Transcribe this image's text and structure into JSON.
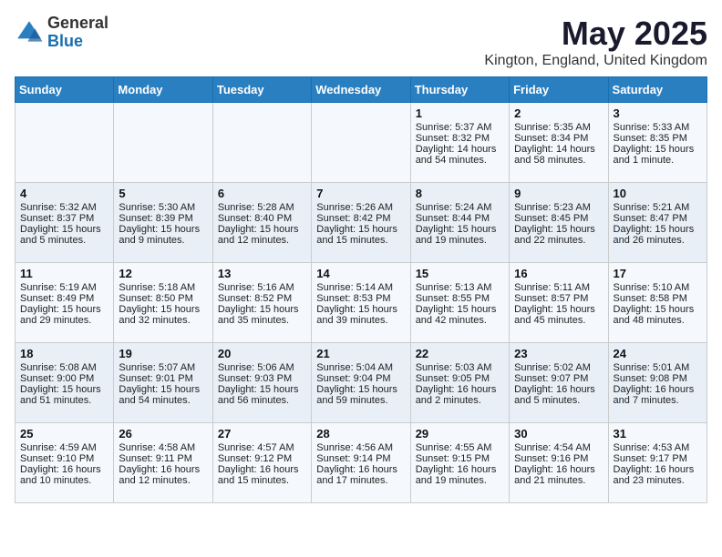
{
  "header": {
    "logo_general": "General",
    "logo_blue": "Blue",
    "month_title": "May 2025",
    "location": "Kington, England, United Kingdom"
  },
  "days_of_week": [
    "Sunday",
    "Monday",
    "Tuesday",
    "Wednesday",
    "Thursday",
    "Friday",
    "Saturday"
  ],
  "weeks": [
    [
      {
        "num": "",
        "sunrise": "",
        "sunset": "",
        "daylight": ""
      },
      {
        "num": "",
        "sunrise": "",
        "sunset": "",
        "daylight": ""
      },
      {
        "num": "",
        "sunrise": "",
        "sunset": "",
        "daylight": ""
      },
      {
        "num": "",
        "sunrise": "",
        "sunset": "",
        "daylight": ""
      },
      {
        "num": "1",
        "sunrise": "Sunrise: 5:37 AM",
        "sunset": "Sunset: 8:32 PM",
        "daylight": "Daylight: 14 hours and 54 minutes."
      },
      {
        "num": "2",
        "sunrise": "Sunrise: 5:35 AM",
        "sunset": "Sunset: 8:34 PM",
        "daylight": "Daylight: 14 hours and 58 minutes."
      },
      {
        "num": "3",
        "sunrise": "Sunrise: 5:33 AM",
        "sunset": "Sunset: 8:35 PM",
        "daylight": "Daylight: 15 hours and 1 minute."
      }
    ],
    [
      {
        "num": "4",
        "sunrise": "Sunrise: 5:32 AM",
        "sunset": "Sunset: 8:37 PM",
        "daylight": "Daylight: 15 hours and 5 minutes."
      },
      {
        "num": "5",
        "sunrise": "Sunrise: 5:30 AM",
        "sunset": "Sunset: 8:39 PM",
        "daylight": "Daylight: 15 hours and 9 minutes."
      },
      {
        "num": "6",
        "sunrise": "Sunrise: 5:28 AM",
        "sunset": "Sunset: 8:40 PM",
        "daylight": "Daylight: 15 hours and 12 minutes."
      },
      {
        "num": "7",
        "sunrise": "Sunrise: 5:26 AM",
        "sunset": "Sunset: 8:42 PM",
        "daylight": "Daylight: 15 hours and 15 minutes."
      },
      {
        "num": "8",
        "sunrise": "Sunrise: 5:24 AM",
        "sunset": "Sunset: 8:44 PM",
        "daylight": "Daylight: 15 hours and 19 minutes."
      },
      {
        "num": "9",
        "sunrise": "Sunrise: 5:23 AM",
        "sunset": "Sunset: 8:45 PM",
        "daylight": "Daylight: 15 hours and 22 minutes."
      },
      {
        "num": "10",
        "sunrise": "Sunrise: 5:21 AM",
        "sunset": "Sunset: 8:47 PM",
        "daylight": "Daylight: 15 hours and 26 minutes."
      }
    ],
    [
      {
        "num": "11",
        "sunrise": "Sunrise: 5:19 AM",
        "sunset": "Sunset: 8:49 PM",
        "daylight": "Daylight: 15 hours and 29 minutes."
      },
      {
        "num": "12",
        "sunrise": "Sunrise: 5:18 AM",
        "sunset": "Sunset: 8:50 PM",
        "daylight": "Daylight: 15 hours and 32 minutes."
      },
      {
        "num": "13",
        "sunrise": "Sunrise: 5:16 AM",
        "sunset": "Sunset: 8:52 PM",
        "daylight": "Daylight: 15 hours and 35 minutes."
      },
      {
        "num": "14",
        "sunrise": "Sunrise: 5:14 AM",
        "sunset": "Sunset: 8:53 PM",
        "daylight": "Daylight: 15 hours and 39 minutes."
      },
      {
        "num": "15",
        "sunrise": "Sunrise: 5:13 AM",
        "sunset": "Sunset: 8:55 PM",
        "daylight": "Daylight: 15 hours and 42 minutes."
      },
      {
        "num": "16",
        "sunrise": "Sunrise: 5:11 AM",
        "sunset": "Sunset: 8:57 PM",
        "daylight": "Daylight: 15 hours and 45 minutes."
      },
      {
        "num": "17",
        "sunrise": "Sunrise: 5:10 AM",
        "sunset": "Sunset: 8:58 PM",
        "daylight": "Daylight: 15 hours and 48 minutes."
      }
    ],
    [
      {
        "num": "18",
        "sunrise": "Sunrise: 5:08 AM",
        "sunset": "Sunset: 9:00 PM",
        "daylight": "Daylight: 15 hours and 51 minutes."
      },
      {
        "num": "19",
        "sunrise": "Sunrise: 5:07 AM",
        "sunset": "Sunset: 9:01 PM",
        "daylight": "Daylight: 15 hours and 54 minutes."
      },
      {
        "num": "20",
        "sunrise": "Sunrise: 5:06 AM",
        "sunset": "Sunset: 9:03 PM",
        "daylight": "Daylight: 15 hours and 56 minutes."
      },
      {
        "num": "21",
        "sunrise": "Sunrise: 5:04 AM",
        "sunset": "Sunset: 9:04 PM",
        "daylight": "Daylight: 15 hours and 59 minutes."
      },
      {
        "num": "22",
        "sunrise": "Sunrise: 5:03 AM",
        "sunset": "Sunset: 9:05 PM",
        "daylight": "Daylight: 16 hours and 2 minutes."
      },
      {
        "num": "23",
        "sunrise": "Sunrise: 5:02 AM",
        "sunset": "Sunset: 9:07 PM",
        "daylight": "Daylight: 16 hours and 5 minutes."
      },
      {
        "num": "24",
        "sunrise": "Sunrise: 5:01 AM",
        "sunset": "Sunset: 9:08 PM",
        "daylight": "Daylight: 16 hours and 7 minutes."
      }
    ],
    [
      {
        "num": "25",
        "sunrise": "Sunrise: 4:59 AM",
        "sunset": "Sunset: 9:10 PM",
        "daylight": "Daylight: 16 hours and 10 minutes."
      },
      {
        "num": "26",
        "sunrise": "Sunrise: 4:58 AM",
        "sunset": "Sunset: 9:11 PM",
        "daylight": "Daylight: 16 hours and 12 minutes."
      },
      {
        "num": "27",
        "sunrise": "Sunrise: 4:57 AM",
        "sunset": "Sunset: 9:12 PM",
        "daylight": "Daylight: 16 hours and 15 minutes."
      },
      {
        "num": "28",
        "sunrise": "Sunrise: 4:56 AM",
        "sunset": "Sunset: 9:14 PM",
        "daylight": "Daylight: 16 hours and 17 minutes."
      },
      {
        "num": "29",
        "sunrise": "Sunrise: 4:55 AM",
        "sunset": "Sunset: 9:15 PM",
        "daylight": "Daylight: 16 hours and 19 minutes."
      },
      {
        "num": "30",
        "sunrise": "Sunrise: 4:54 AM",
        "sunset": "Sunset: 9:16 PM",
        "daylight": "Daylight: 16 hours and 21 minutes."
      },
      {
        "num": "31",
        "sunrise": "Sunrise: 4:53 AM",
        "sunset": "Sunset: 9:17 PM",
        "daylight": "Daylight: 16 hours and 23 minutes."
      }
    ]
  ]
}
